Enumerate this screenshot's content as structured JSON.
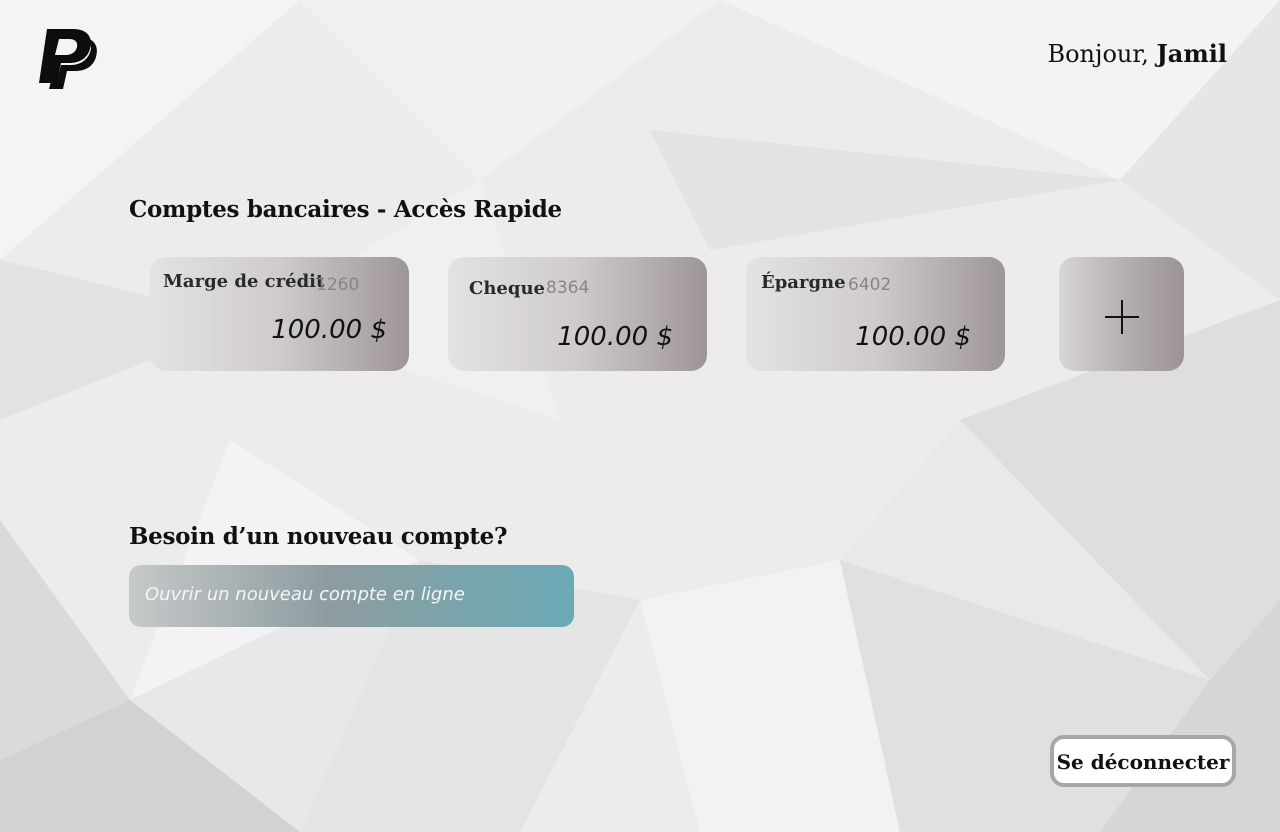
{
  "header": {
    "logo_icon": "paypal-logo",
    "greeting_prefix": "Bonjour, ",
    "user_name": "Jamil"
  },
  "quick_access": {
    "title": "Comptes bancaires - Accès Rapide",
    "accounts": [
      {
        "name": "Marge de crédit",
        "number": "1260",
        "balance": "100.00 $"
      },
      {
        "name": "Cheque",
        "number": "8364",
        "balance": "100.00 $"
      },
      {
        "name": "Épargne",
        "number": "6402",
        "balance": "100.00 $"
      }
    ],
    "add_icon": "plus-icon"
  },
  "new_account": {
    "title": "Besoin d’un nouveau compte?",
    "open_button_label": "Ouvrir un nouveau compte en ligne"
  },
  "footer": {
    "logout_label": "Se déconnecter"
  },
  "colors": {
    "card_gradient_start": "#e4e2e2",
    "card_gradient_end": "#9e9696",
    "open_button_gradient_end": "#6aaab6",
    "logout_border": "#a7a7a7"
  }
}
